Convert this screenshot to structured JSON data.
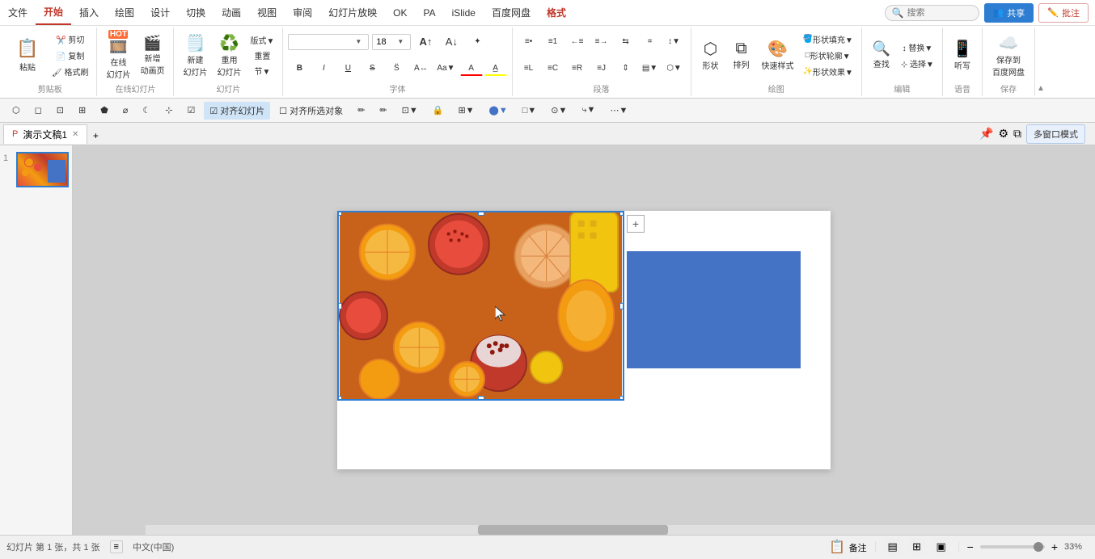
{
  "app": {
    "title": "演示文稿1",
    "tabs": [
      "文件",
      "开始",
      "插入",
      "绘图",
      "设计",
      "切换",
      "动画",
      "视图",
      "审阅",
      "幻灯片放映",
      "OK",
      "PA",
      "iSlide",
      "百度网盘",
      "格式"
    ],
    "active_tab": "开始",
    "format_tab": "格式"
  },
  "ribbon": {
    "groups": [
      {
        "name": "剪贴板",
        "buttons": [
          "粘贴",
          "剪切",
          "复制",
          "格式刷"
        ]
      },
      {
        "name": "在线幻灯片",
        "buttons": [
          "在线幻灯片",
          "新增动画页"
        ]
      },
      {
        "name": "幻灯片",
        "buttons": [
          "新建幻灯片",
          "重用幻灯片",
          "节▼"
        ]
      },
      {
        "name": "字体",
        "font_name": "",
        "font_size": "18",
        "buttons": [
          "B",
          "I",
          "U",
          "S",
          "A",
          "A↑",
          "A↓"
        ]
      },
      {
        "name": "段落",
        "buttons": [
          "对齐",
          "列表"
        ]
      },
      {
        "name": "绘图",
        "buttons": [
          "形状",
          "排列",
          "快速样式"
        ]
      },
      {
        "name": "编辑",
        "buttons": [
          "查找",
          "替换",
          "选择"
        ]
      },
      {
        "name": "语音",
        "buttons": [
          "听写"
        ]
      },
      {
        "name": "保存",
        "buttons": [
          "保存到百度网盘"
        ]
      }
    ]
  },
  "quick_toolbar": {
    "items": [
      "对齐幻灯片",
      "对齐所选对象"
    ],
    "align_slide_checked": true,
    "align_selected_checked": false
  },
  "tab_bar": {
    "tabs": [
      {
        "label": "演示文稿1",
        "active": true
      }
    ],
    "add_label": "+"
  },
  "slide_panel": {
    "slides": [
      {
        "number": "1"
      }
    ]
  },
  "canvas": {
    "has_image": true,
    "has_blue_rect": true,
    "plus_btn": "+",
    "image_alt": "水果图片"
  },
  "status_bar": {
    "slide_info": "幻灯片 第 1 张，共 1 张",
    "lang": "中文(中国)",
    "notes_label": "备注",
    "view_normal": "▤",
    "view_slide_sorter": "⊞",
    "view_reading": "▣",
    "zoom_label": "33%",
    "multi_window": "多窗口模式"
  },
  "top_right": {
    "share_label": "共享",
    "comment_label": "批注",
    "search_placeholder": "搜索"
  },
  "shapes_panel": {
    "shape_fill_label": "形状填充",
    "shape_outline_label": "形状轮廓",
    "shape_effect_label": "形状效果"
  }
}
